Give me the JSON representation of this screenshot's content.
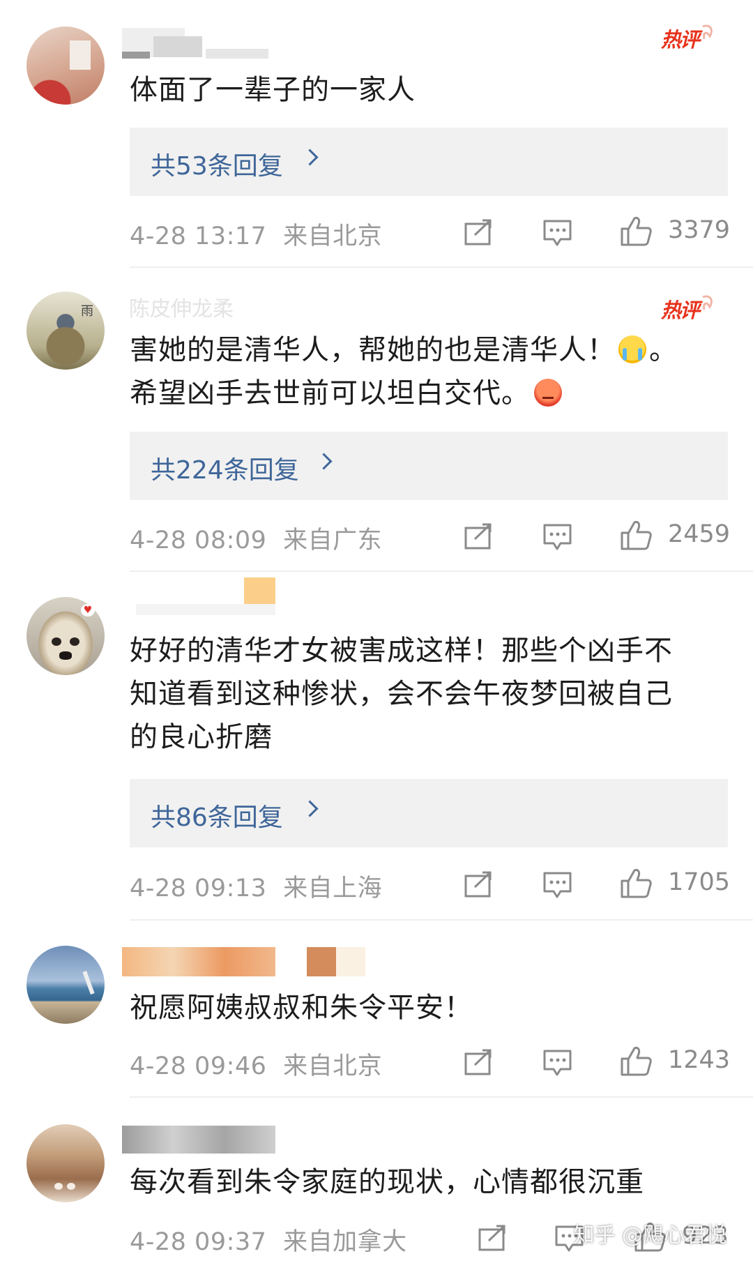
{
  "comments": [
    {
      "hot_label": "热评",
      "text": "体面了一辈子的一家人",
      "replies_label": "共53条回复",
      "time": "4-28 13:17",
      "location": "来自北京",
      "likes": "3379"
    },
    {
      "username": "陈皮伸龙柔",
      "hot_label": "热评",
      "text_line1": "害她的是清华人，帮她的也是清华人！",
      "text_line1_end": "。",
      "text_line2": "希望凶手去世前可以坦白交代。",
      "emoji1": "crying-face-emoji",
      "emoji2": "angry-face-emoji",
      "replies_label": "共224条回复",
      "time": "4-28 08:09",
      "location": "来自广东",
      "likes": "2459"
    },
    {
      "text_line1": "好好的清华才女被害成这样！那些个凶手不",
      "text_line2": "知道看到这种惨状，会不会午夜梦回被自己",
      "text_line3": "的良心折磨",
      "replies_label": "共86条回复",
      "time": "4-28 09:13",
      "location": "来自上海",
      "likes": "1705"
    },
    {
      "text": "祝愿阿姨叔叔和朱令平安！",
      "time": "4-28 09:46",
      "location": "来自北京",
      "likes": "1243"
    },
    {
      "text": "每次看到朱令家庭的现状，心情都很沉重",
      "time": "4-28 09:37",
      "location": "来自加拿大",
      "likes": "923"
    }
  ],
  "icons": {
    "share": "share-icon",
    "comment": "comment-icon",
    "like": "thumbs-up-icon",
    "hot": "hot-comment-badge"
  },
  "watermark": "知乎 @飓心君悦",
  "colors": {
    "reply_link": "#3f6699",
    "hot_badge": "#e8321c",
    "meta_text": "#9a9a9a",
    "reply_bg": "#f1f1f1"
  }
}
